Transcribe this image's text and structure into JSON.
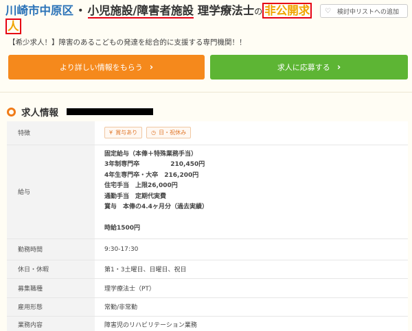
{
  "title": {
    "area": "川崎市中原区",
    "dot": "・",
    "facility": "小児施設/障害者施設",
    "job": " 理学療法士",
    "no": "の",
    "private_a": "非公開求",
    "private_b": "人"
  },
  "favorite_label": "検討中リストへの追加",
  "lead": "【希少求人！】障害のあるこどもの発達を総合的に支援する専門機関！！",
  "buttons": {
    "info": "より詳しい情報をもらう",
    "apply": "求人に応募する"
  },
  "section_title": "求人情報",
  "table": {
    "rows": [
      {
        "label": "特徴",
        "tags": [
          "賞与あり",
          "日・祝休み"
        ]
      },
      {
        "label": "給与",
        "lines": [
          "固定給与（本俸＋特殊業務手当）",
          "3年制専門卒　　　　　210,450円",
          "4年生専門卒・大卒　216,200円",
          "住宅手当　上限26,000円",
          "通勤手当　定期代実費",
          "賞与　本俸の4.4ヶ月分（過去実績）",
          "",
          "時給1500円"
        ]
      },
      {
        "label": "勤務時間",
        "value": "9:30-17:30"
      },
      {
        "label": "休日・休暇",
        "value": "第1・3土曜日、日曜日、祝日"
      },
      {
        "label": "募集職種",
        "value": "理学療法士（PT）"
      },
      {
        "label": "雇用形態",
        "value": "常勤/非常勤"
      },
      {
        "label": "業務内容",
        "value": "障害児のリハビリテーション業務"
      }
    ]
  },
  "colors": {
    "area": "#2b73b8",
    "orange": "#f5891c",
    "green": "#5db534",
    "private": "#f0a400",
    "highlight": "#e60012"
  }
}
